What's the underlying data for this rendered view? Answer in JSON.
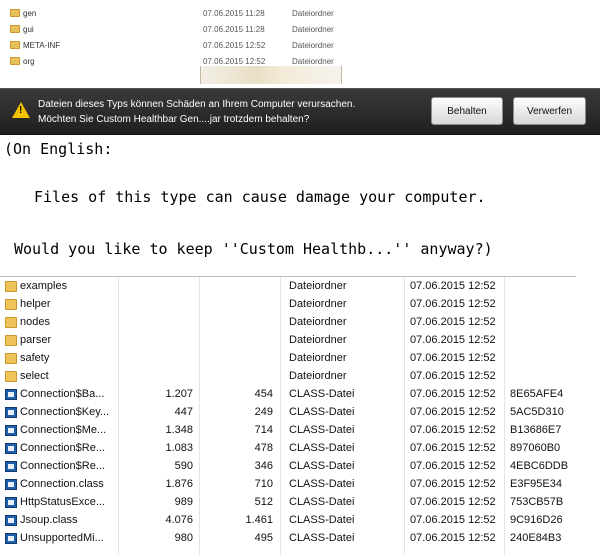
{
  "top_list": {
    "rows": [
      {
        "name": "gen",
        "date": "07.06.2015 11:28",
        "type": "Dateiordner"
      },
      {
        "name": "gui",
        "date": "07.06.2015 11:28",
        "type": "Dateiordner"
      },
      {
        "name": "META-INF",
        "date": "07.06.2015 12:52",
        "type": "Dateiordner"
      },
      {
        "name": "org",
        "date": "07.06.2015 12:52",
        "type": "Dateiordner"
      }
    ]
  },
  "notification": {
    "icon": "warning-icon",
    "line1": "Dateien dieses Typs können Schäden an Ihrem Computer verursachen.",
    "line2": "Möchten Sie Custom Healthbar Gen....jar trotzdem behalten?",
    "keep_label": "Behalten",
    "discard_label": "Verwerfen"
  },
  "translation": {
    "line1": "(On English:",
    "line2": "Files of this type can cause damage your computer.",
    "line3": "Would you like to keep ''Custom Healthb...'' anyway?)"
  },
  "file_list": {
    "rows": [
      {
        "icon": "folder",
        "name": "examples",
        "size": "",
        "compressed": "",
        "type": "Dateiordner",
        "date": "07.06.2015 12:52",
        "crc": ""
      },
      {
        "icon": "folder",
        "name": "helper",
        "size": "",
        "compressed": "",
        "type": "Dateiordner",
        "date": "07.06.2015 12:52",
        "crc": ""
      },
      {
        "icon": "folder",
        "name": "nodes",
        "size": "",
        "compressed": "",
        "type": "Dateiordner",
        "date": "07.06.2015 12:52",
        "crc": ""
      },
      {
        "icon": "folder",
        "name": "parser",
        "size": "",
        "compressed": "",
        "type": "Dateiordner",
        "date": "07.06.2015 12:52",
        "crc": ""
      },
      {
        "icon": "folder",
        "name": "safety",
        "size": "",
        "compressed": "",
        "type": "Dateiordner",
        "date": "07.06.2015 12:52",
        "crc": ""
      },
      {
        "icon": "folder",
        "name": "select",
        "size": "",
        "compressed": "",
        "type": "Dateiordner",
        "date": "07.06.2015 12:52",
        "crc": ""
      },
      {
        "icon": "class",
        "name": "Connection$Ba...",
        "size": "1.207",
        "compressed": "454",
        "type": "CLASS-Datei",
        "date": "07.06.2015 12:52",
        "crc": "8E65AFE4"
      },
      {
        "icon": "class",
        "name": "Connection$Key...",
        "size": "447",
        "compressed": "249",
        "type": "CLASS-Datei",
        "date": "07.06.2015 12:52",
        "crc": "5AC5D310"
      },
      {
        "icon": "class",
        "name": "Connection$Me...",
        "size": "1.348",
        "compressed": "714",
        "type": "CLASS-Datei",
        "date": "07.06.2015 12:52",
        "crc": "B13686E7"
      },
      {
        "icon": "class",
        "name": "Connection$Re...",
        "size": "1.083",
        "compressed": "478",
        "type": "CLASS-Datei",
        "date": "07.06.2015 12:52",
        "crc": "897060B0"
      },
      {
        "icon": "class",
        "name": "Connection$Re...",
        "size": "590",
        "compressed": "346",
        "type": "CLASS-Datei",
        "date": "07.06.2015 12:52",
        "crc": "4EBC6DDB"
      },
      {
        "icon": "class",
        "name": "Connection.class",
        "size": "1.876",
        "compressed": "710",
        "type": "CLASS-Datei",
        "date": "07.06.2015 12:52",
        "crc": "E3F95E34"
      },
      {
        "icon": "class",
        "name": "HttpStatusExce...",
        "size": "989",
        "compressed": "512",
        "type": "CLASS-Datei",
        "date": "07.06.2015 12:52",
        "crc": "753CB57B"
      },
      {
        "icon": "class",
        "name": "Jsoup.class",
        "size": "4.076",
        "compressed": "1.461",
        "type": "CLASS-Datei",
        "date": "07.06.2015 12:52",
        "crc": "9C916D26"
      },
      {
        "icon": "class",
        "name": "UnsupportedMi...",
        "size": "980",
        "compressed": "495",
        "type": "CLASS-Datei",
        "date": "07.06.2015 12:52",
        "crc": "240E84B3"
      }
    ]
  }
}
